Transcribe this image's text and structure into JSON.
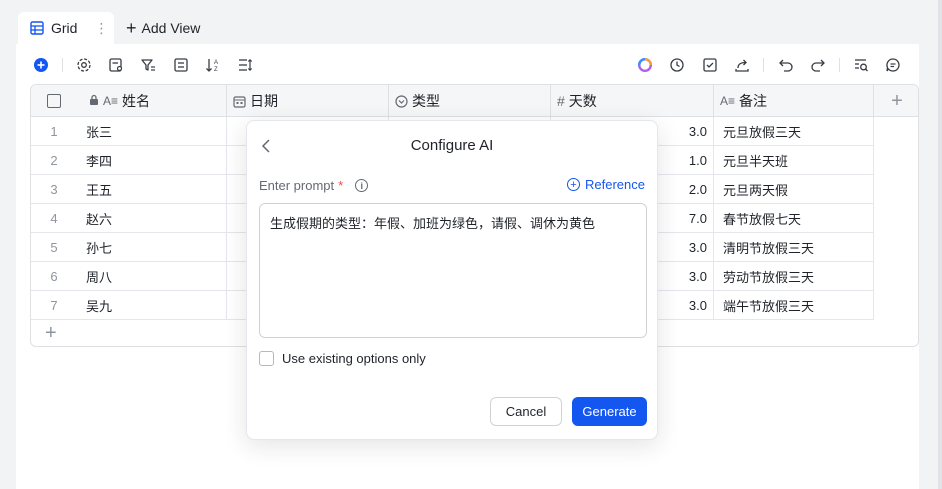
{
  "tabs": {
    "active_label": "Grid",
    "more": "⋮",
    "add_view": "Add View"
  },
  "table": {
    "columns": [
      {
        "label": "姓名",
        "icon": "text-icon"
      },
      {
        "label": "日期",
        "icon": "calendar-icon"
      },
      {
        "label": "类型",
        "icon": "single-select-icon"
      },
      {
        "label": "天数",
        "icon": "number-icon"
      },
      {
        "label": "备注",
        "icon": "text-icon"
      }
    ],
    "rows": [
      {
        "n": "1",
        "name": "张三",
        "days": "3.0",
        "note": "元旦放假三天"
      },
      {
        "n": "2",
        "name": "李四",
        "days": "1.0",
        "note": "元旦半天班"
      },
      {
        "n": "3",
        "name": "王五",
        "days": "2.0",
        "note": "元旦两天假"
      },
      {
        "n": "4",
        "name": "赵六",
        "days": "7.0",
        "note": "春节放假七天"
      },
      {
        "n": "5",
        "name": "孙七",
        "days": "3.0",
        "note": "清明节放假三天"
      },
      {
        "n": "6",
        "name": "周八",
        "days": "3.0",
        "note": "劳动节放假三天"
      },
      {
        "n": "7",
        "name": "吴九",
        "days": "3.0",
        "note": "端午节放假三天"
      }
    ]
  },
  "dialog": {
    "title": "Configure AI",
    "prompt_label": "Enter prompt",
    "required_mark": "*",
    "reference_label": "Reference",
    "prompt_value": "生成假期的类型：年假、加班为绿色，请假、调休为黄色",
    "checkbox_label": "Use existing options only",
    "cancel_label": "Cancel",
    "generate_label": "Generate"
  },
  "colors": {
    "accent": "#1456f0",
    "required": "#f54a45",
    "header_bg": "#f5f6f7"
  }
}
